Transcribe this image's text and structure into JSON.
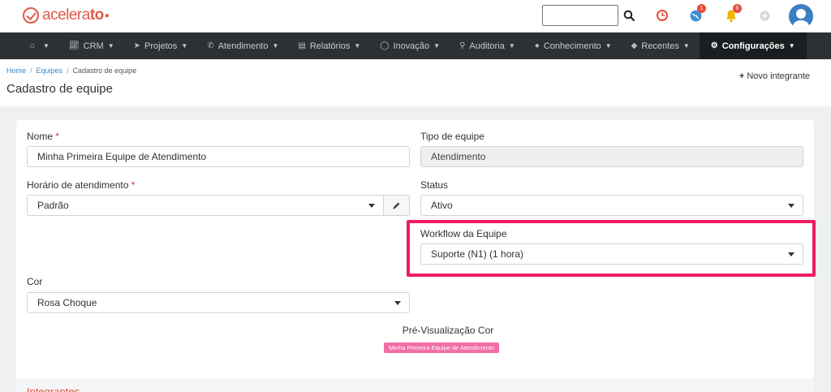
{
  "header": {
    "logo_text_light": "acelera",
    "logo_text_bold": "to",
    "search_value": "",
    "badges": {
      "notifications_blue": "1",
      "notifications_bell": "6"
    }
  },
  "nav": {
    "items": [
      {
        "icon": "home-icon",
        "label": ""
      },
      {
        "icon": "chart-icon",
        "label": "CRM"
      },
      {
        "icon": "send-icon",
        "label": "Projetos"
      },
      {
        "icon": "phone-icon",
        "label": "Atendimento"
      },
      {
        "icon": "document-icon",
        "label": "Relatórios"
      },
      {
        "icon": "lightbulb-icon",
        "label": "Inovação"
      },
      {
        "icon": "search-icon",
        "label": "Auditoria"
      },
      {
        "icon": "chat-icon",
        "label": "Conhecimento"
      },
      {
        "icon": "tag-icon",
        "label": "Recentes"
      },
      {
        "icon": "gear-icon",
        "label": "Configurações"
      }
    ]
  },
  "breadcrumb": {
    "home": "Home",
    "teams": "Equipes",
    "current": "Cadastro de equipe"
  },
  "page": {
    "title": "Cadastro de equipe",
    "new_member": "Novo integrante"
  },
  "form": {
    "name_label": "Nome",
    "name_value": "Minha Primeira Equipe de Atendimento",
    "type_label": "Tipo de equipe",
    "type_value": "Atendimento",
    "schedule_label": "Horário de atendimento",
    "schedule_value": "Padrão",
    "status_label": "Status",
    "status_value": "Ativo",
    "workflow_label": "Workflow da Equipe",
    "workflow_value": "Suporte (N1) (1 hora)",
    "color_label": "Cor",
    "color_value": "Rosa Choque",
    "preview_label": "Pré-Visualização Cor",
    "preview_badge": "Minha Primeira Equipe de Atendimento",
    "required_mark": "*"
  },
  "sections": {
    "members": "Integrantes"
  },
  "colors": {
    "brand": "#e05a47",
    "navbar": "#2c3135",
    "highlight": "#ef1c62",
    "preview_badge": "#f16da6"
  }
}
